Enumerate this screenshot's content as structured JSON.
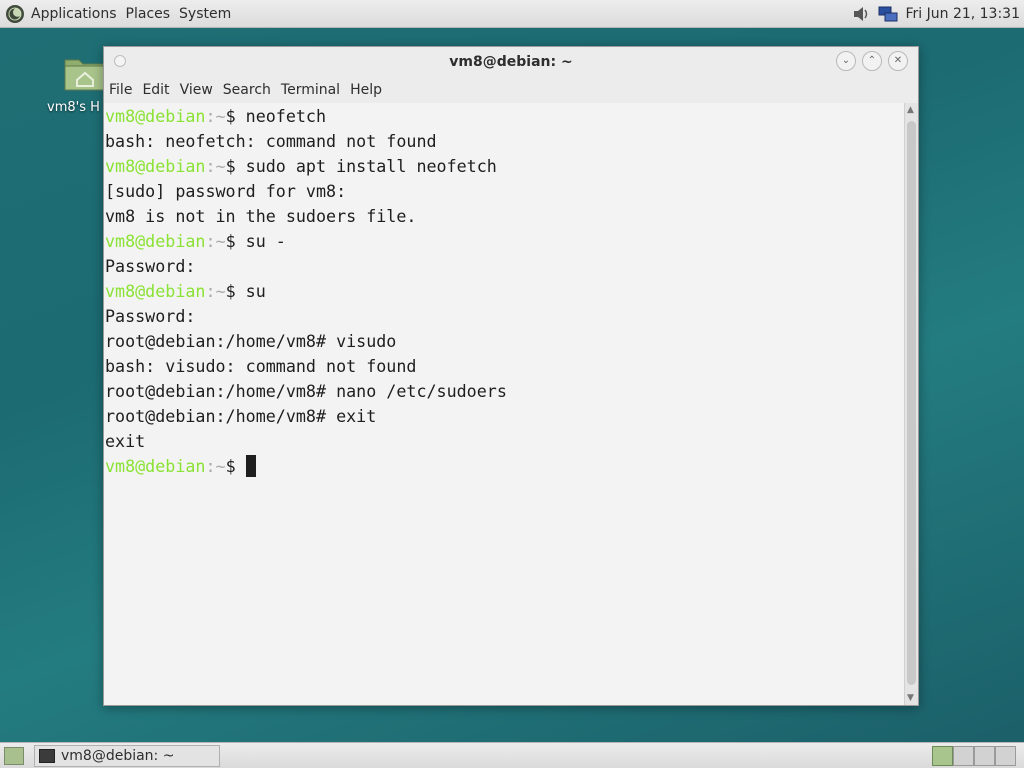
{
  "top_panel": {
    "menus": [
      "Applications",
      "Places",
      "System"
    ],
    "clock": "Fri Jun 21, 13:31",
    "icons": [
      "debian-logo-icon",
      "volume-icon",
      "network-icon"
    ]
  },
  "desktop": {
    "home_icon_label": "vm8's H"
  },
  "window": {
    "title": "vm8@debian: ~",
    "menubar": [
      "File",
      "Edit",
      "View",
      "Search",
      "Terminal",
      "Help"
    ],
    "buttons": [
      "minimize-icon",
      "maximize-icon",
      "close-icon"
    ]
  },
  "terminal": {
    "lines": [
      {
        "type": "prompt",
        "user": "vm8@debian",
        "sep": ":~",
        "sym": "$",
        "cmd": " neofetch"
      },
      {
        "type": "text",
        "text": "bash: neofetch: command not found"
      },
      {
        "type": "prompt",
        "user": "vm8@debian",
        "sep": ":~",
        "sym": "$",
        "cmd": " sudo apt install neofetch"
      },
      {
        "type": "text",
        "text": "[sudo] password for vm8:"
      },
      {
        "type": "text",
        "text": "vm8 is not in the sudoers file."
      },
      {
        "type": "prompt",
        "user": "vm8@debian",
        "sep": ":~",
        "sym": "$",
        "cmd": " su -"
      },
      {
        "type": "text",
        "text": "Password:"
      },
      {
        "type": "prompt",
        "user": "vm8@debian",
        "sep": ":~",
        "sym": "$",
        "cmd": " su"
      },
      {
        "type": "text",
        "text": "Password:"
      },
      {
        "type": "text",
        "text": "root@debian:/home/vm8# visudo"
      },
      {
        "type": "text",
        "text": "bash: visudo: command not found"
      },
      {
        "type": "text",
        "text": "root@debian:/home/vm8# nano /etc/sudoers"
      },
      {
        "type": "text",
        "text": "root@debian:/home/vm8# exit"
      },
      {
        "type": "text",
        "text": "exit"
      },
      {
        "type": "prompt",
        "user": "vm8@debian",
        "sep": ":~",
        "sym": "$",
        "cmd": " ",
        "cursor": true
      }
    ]
  },
  "bottom_panel": {
    "task_label": "vm8@debian: ~",
    "workspaces": 4,
    "active_workspace": 1
  },
  "colors": {
    "prompt_user": "#8ae234",
    "prompt_sep": "#aaaaaa",
    "terminal_bg": "#f3f3f3",
    "terminal_fg": "#1e1e1e"
  }
}
